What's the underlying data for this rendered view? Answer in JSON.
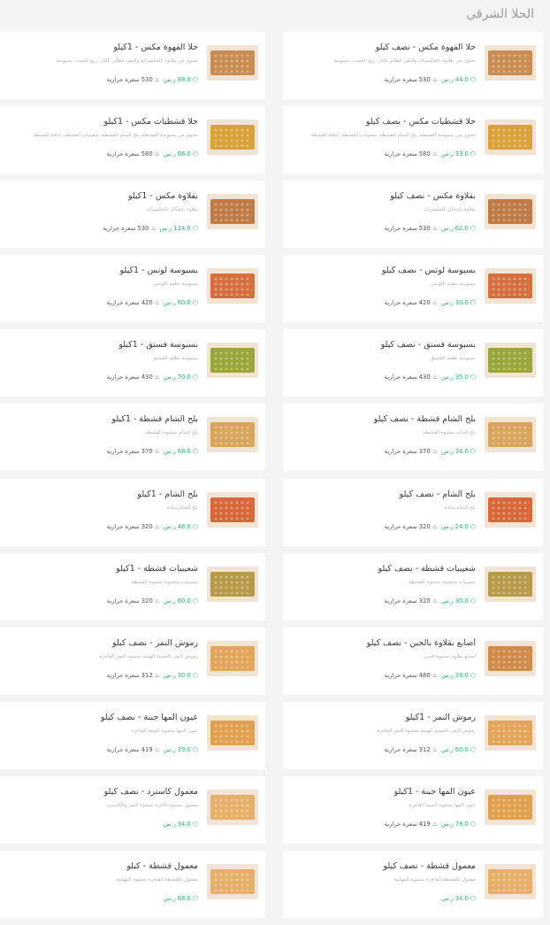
{
  "section": {
    "title": "الحلا الشرقي"
  },
  "units": {
    "currency": "ر.س",
    "calories": "سعرة حرارية"
  },
  "products": [
    {
      "name": "حلا القهوة مكس - نصف كيلو",
      "desc": "تحتوي من بقلاوة بالمكسرات والتمر، فطاير بالنار، زنود الست، بسبوسة",
      "price": "44.0",
      "calories": "530",
      "col": "right",
      "row": 1,
      "img": "#c98d52"
    },
    {
      "name": "حلا القهوة مكس - 1كيلو",
      "desc": "تحتوي من بقلاوة بالمكسرات والتمر، فطاير بالنار، زنود الست، بسبوسة",
      "price": "88.0",
      "calories": "530",
      "col": "left",
      "row": 1,
      "img": "#c98d52"
    },
    {
      "name": "حلا قشطيات مكس - نصف كيلو",
      "desc": "تحتوي من بسبوسة القشطة، بلح الشام القشطة، شعيبيات القشطة، كنافة القشطة",
      "price": "33.0",
      "calories": "580",
      "col": "right",
      "row": 2,
      "img": "#d9a23a"
    },
    {
      "name": "حلا قشطيات مكس - 1كيلو",
      "desc": "تحتوي من بسبوسة القشطة، بلح الشام القشطة، شعيبيات القشطة، كنافة القشطة",
      "price": "66.0",
      "calories": "580",
      "col": "left",
      "row": 2,
      "img": "#d9a23a"
    },
    {
      "name": "بقلاوة مكس - نصف كيلو",
      "desc": "بقلاوة بأشكال بالمكسرات",
      "price": "62.0",
      "calories": "530",
      "col": "right",
      "row": 3,
      "img": "#c07a45"
    },
    {
      "name": "بقلاوة مكس - 1كيلو",
      "desc": "بقلاوة بأشكال بالمكسرات",
      "price": "124.0",
      "calories": "530",
      "col": "left",
      "row": 3,
      "img": "#c07a45"
    },
    {
      "name": "بسبوسة لوتس - نصف كيلو",
      "desc": "بسبوسة بطعم اللوتس",
      "price": "30.0",
      "calories": "420",
      "col": "right",
      "row": 4,
      "img": "#d4703f"
    },
    {
      "name": "بسبوسة لوتس - 1كيلو",
      "desc": "بسبوسة بطعم اللوتس",
      "price": "60.0",
      "calories": "420",
      "col": "left",
      "row": 4,
      "img": "#d4703f"
    },
    {
      "name": "بسبوسة فستق - نصف كيلو",
      "desc": "بسبوسة بطعم الفستق",
      "price": "35.0",
      "calories": "430",
      "col": "right",
      "row": 5,
      "img": "#9aa63c"
    },
    {
      "name": "بسبوسة فستق - 1كيلو",
      "desc": "بسبوسة بطعم الفستق",
      "price": "70.0",
      "calories": "430",
      "col": "left",
      "row": 5,
      "img": "#9aa63c"
    },
    {
      "name": "بلح الشام قشطة - نصف كيلو",
      "desc": "بلح الشام بحشوة القشطة",
      "price": "34.0",
      "calories": "370",
      "col": "right",
      "row": 6,
      "img": "#d8a55a"
    },
    {
      "name": "بلح الشام قشطة - 1كيلو",
      "desc": "بلح الشام بحشوة القشطة",
      "price": "68.0",
      "calories": "370",
      "col": "left",
      "row": 6,
      "img": "#d8a55a"
    },
    {
      "name": "بلح الشام - نصف كيلو",
      "desc": "بلح الشام سادة",
      "price": "24.0",
      "calories": "320",
      "col": "right",
      "row": 7,
      "img": "#d8683a"
    },
    {
      "name": "بلح الشام - 1كيلو",
      "desc": "بلح الشام سادة",
      "price": "48.0",
      "calories": "320",
      "col": "left",
      "row": 7,
      "img": "#d8683a"
    },
    {
      "name": "شعيبيات قشطة - نصف كيلو",
      "desc": "شعيبيات محشوة بحشوة القشطة",
      "price": "30.0",
      "calories": "320",
      "col": "right",
      "row": 8,
      "img": "#b79a4a"
    },
    {
      "name": "شعيبيات قشطة - 1كيلو",
      "desc": "شعيبيات محشوة بحشوة القشطة",
      "price": "60.0",
      "calories": "320",
      "col": "left",
      "row": 8,
      "img": "#b79a4a"
    },
    {
      "name": "أصابع بقلاوة بالجبن - نصف كيلو",
      "desc": "أصابع بقلاوة بحشوة الجبن",
      "price": "39.0",
      "calories": "480",
      "col": "right",
      "row": 9,
      "img": "#d08a4a"
    },
    {
      "name": "رموش التمر - نصف كيلو",
      "desc": "رموش التمر بالعجينة الهشة بحشوة التمر الفاخرة",
      "price": "30.0",
      "calories": "312",
      "col": "left",
      "row": 9,
      "img": "#e2a55a"
    },
    {
      "name": "رموش التمر - 1كيلو",
      "desc": "رموش التمر بالعجينة الهشة بحشوة التمر الفاخرة",
      "price": "60.0",
      "calories": "312",
      "col": "right",
      "row": 10,
      "img": "#e2a55a"
    },
    {
      "name": "عيون المها جبنة - نصف كيلو",
      "desc": "عيون المها بحشوة الجبنة الفاخرة",
      "price": "39.0",
      "calories": "419",
      "col": "left",
      "row": 10,
      "img": "#e0a050"
    },
    {
      "name": "عيون المها جبنة - 1كيلو",
      "desc": "عيون المها بحشوة الجبنة الفاخرة",
      "price": "78.0",
      "calories": "419",
      "col": "right",
      "row": 11,
      "img": "#e0a050"
    },
    {
      "name": "معمول كاسترد - نصف كيلو",
      "desc": "معمول بحشوة فاخرة بحشوة التمر والكاسترد",
      "price": "34.0",
      "calories": "",
      "col": "left",
      "row": 11,
      "img": "#e6b06a"
    },
    {
      "name": "معمول قشطة - نصف كيلو",
      "desc": "معمول بالقشطة الفاخرة بحشوة المهلبية",
      "price": "34.0",
      "calories": "",
      "col": "right",
      "row": 12,
      "img": "#e6b06a"
    },
    {
      "name": "معمول قشطة - كيلو",
      "desc": "معمول بالقشطة الفاخرة بحشوة المهلبية",
      "price": "68.0",
      "calories": "",
      "col": "left",
      "row": 12,
      "img": "#e6b06a"
    }
  ]
}
